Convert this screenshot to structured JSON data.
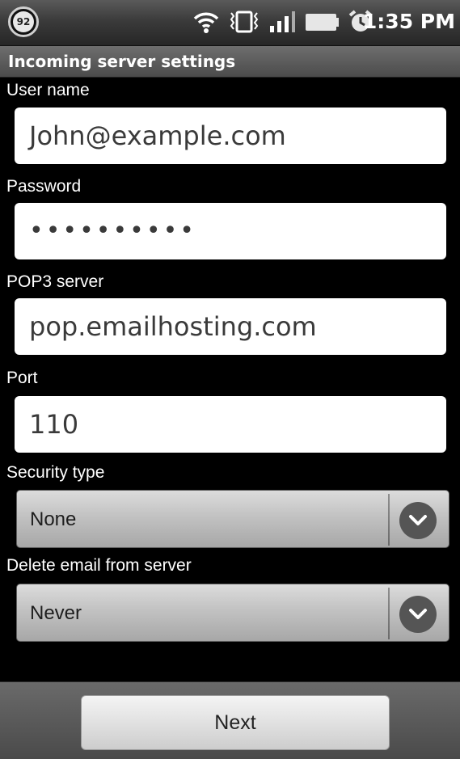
{
  "status_bar": {
    "battery_level": "92",
    "time": "1:35 PM",
    "icons": [
      "wifi-icon",
      "vibrate-icon",
      "signal-icon",
      "battery-icon",
      "alarm-icon"
    ]
  },
  "header": {
    "title": "Incoming server settings"
  },
  "form": {
    "username": {
      "label": "User name",
      "value": "John@example.com"
    },
    "password": {
      "label": "Password",
      "value": "••••••••••"
    },
    "pop3_server": {
      "label": "POP3 server",
      "value": "pop.emailhosting.com"
    },
    "port": {
      "label": "Port",
      "value": "110"
    },
    "security_type": {
      "label": "Security type",
      "selected": "None"
    },
    "delete_email": {
      "label": "Delete email from server",
      "selected": "Never"
    }
  },
  "footer": {
    "next_label": "Next"
  },
  "colors": {
    "field_bg": "#ffffff",
    "dropdown_bg": "#c2c2c2",
    "bar_bg": "#4b4b4b"
  }
}
